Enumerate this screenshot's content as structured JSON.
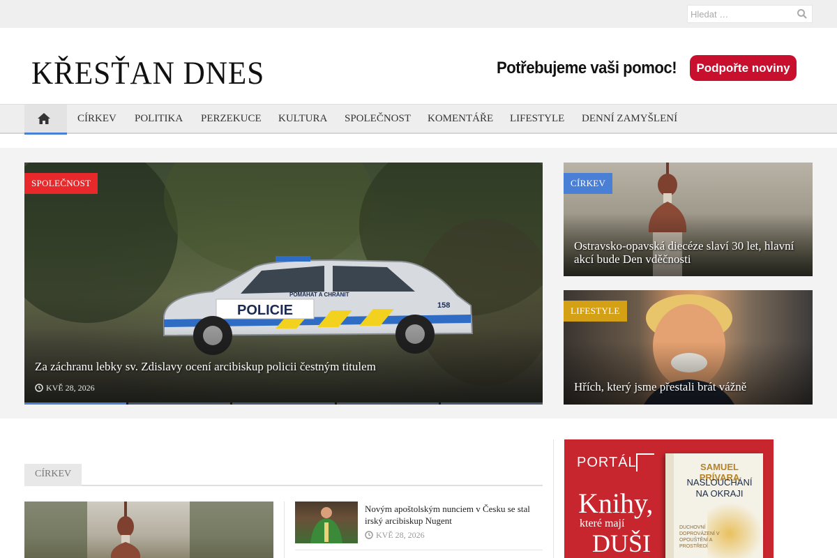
{
  "search": {
    "placeholder": "Hledat …"
  },
  "header": {
    "logo": "KŘESŤAN DNES",
    "help_text": "Potřebujeme vaši pomoc!",
    "support_label": "Podpořte noviny"
  },
  "nav": {
    "items": [
      "CÍRKEV",
      "POLITIKA",
      "PERZEKUCE",
      "KULTURA",
      "SPOLEČNOST",
      "KOMENTÁŘE",
      "LIFESTYLE",
      "DENNÍ ZAMYŠLENÍ"
    ]
  },
  "hero": {
    "category": "SPOLEČNOST",
    "title": "Za záchranu lebky sv. Zdislavy ocení arcibiskup policii čestným titulem",
    "date": "KVĚ 28, 2026",
    "slides": 5,
    "active_slide": 1,
    "photo_text": {
      "sign": "POLICIE",
      "tag": "POMÁHAT A CHRÁNIT",
      "number": "158"
    }
  },
  "side_features": [
    {
      "category": "CÍRKEV",
      "title": "Ostravsko-opavská diecéze slaví 30 let, hlavní akcí bude Den vděčnosti"
    },
    {
      "category": "LIFESTYLE",
      "title": "Hřích, který jsme přestali brát vážně"
    }
  ],
  "section": {
    "label": "CÍRKEV",
    "news": [
      {
        "title": "Novým apoštolským nunciem v Česku se stal irský arcibiskup Nugent",
        "date": "KVĚ 28, 2026"
      }
    ]
  },
  "ad": {
    "brand": "PORTÁL",
    "line1": "Knihy,",
    "line2": "které mají",
    "line3": "DUŠI",
    "book_author": "SAMUEL PRÍVARA",
    "book_title": "NASLOUCHÁNÍ NA OKRAJI",
    "book_subtitle": "DUCHOVNÍ DOPROVÁZENÍ V OPOUŠTĚNÍ A PROSTŘEDÍ"
  },
  "colors": {
    "accent": "#4a7fd6",
    "spolecnost": "#e8282b",
    "lifestyle": "#d4a016",
    "support": "#c8102e"
  }
}
